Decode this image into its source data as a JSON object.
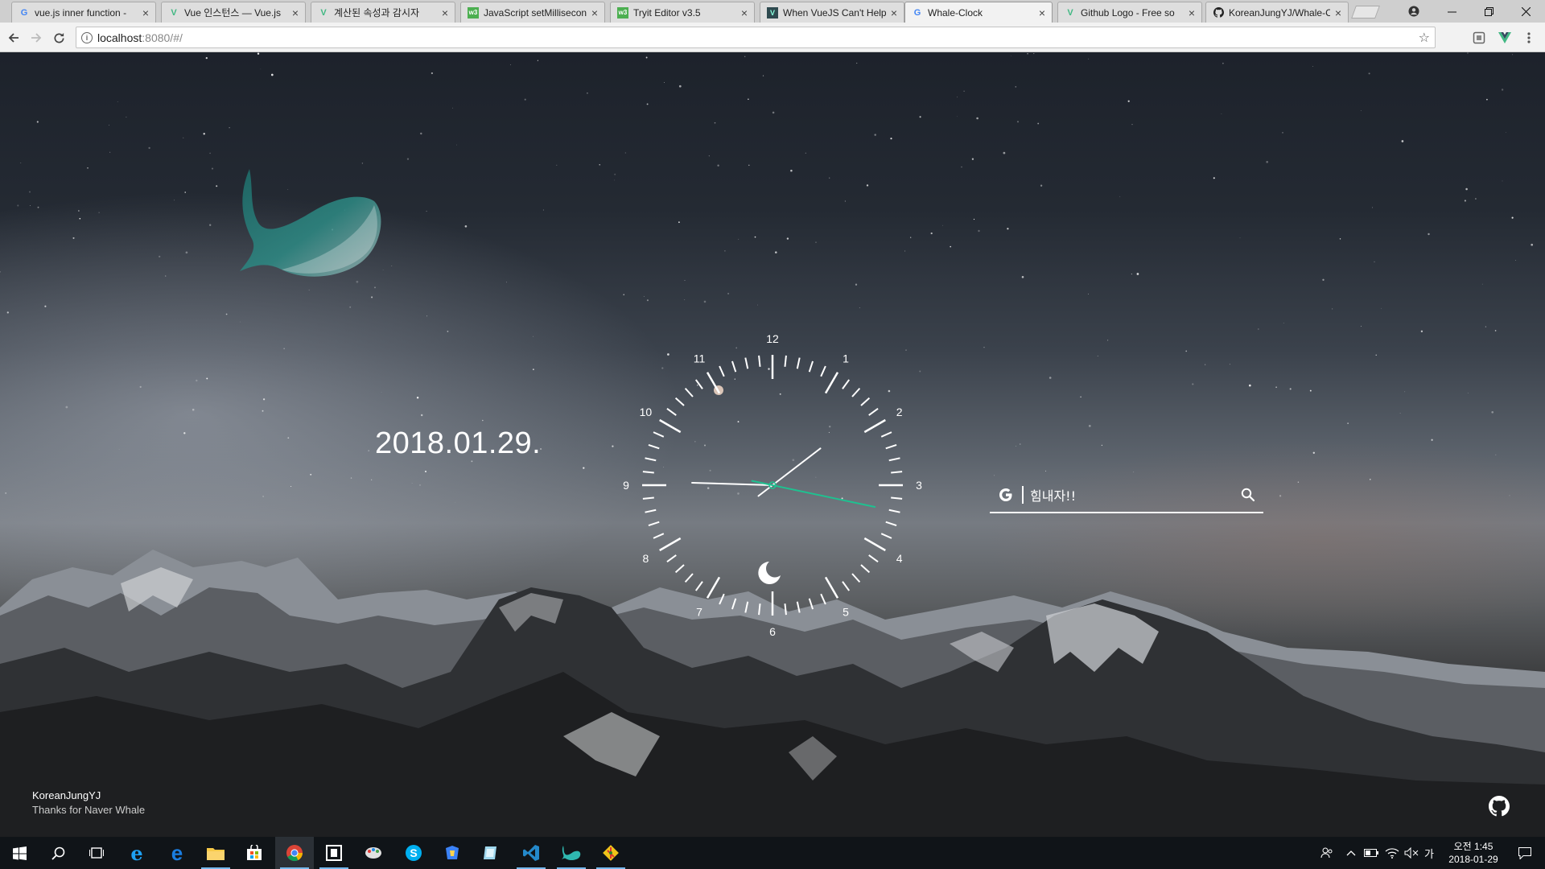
{
  "browser": {
    "tabs": [
      {
        "title": "vue.js inner function -",
        "favicon": "google-icon",
        "active": false
      },
      {
        "title": "Vue 인스턴스 — Vue.js",
        "favicon": "vue-icon",
        "active": false
      },
      {
        "title": "계산된 속성과 감시자",
        "favicon": "vue-icon",
        "active": false
      },
      {
        "title": "JavaScript setMillisecon",
        "favicon": "w3schools-icon",
        "active": false
      },
      {
        "title": "Tryit Editor v3.5",
        "favicon": "w3schools-icon",
        "active": false
      },
      {
        "title": "When VueJS Can't Help",
        "favicon": "medium-icon",
        "active": false
      },
      {
        "title": "Whale-Clock",
        "favicon": "google-icon",
        "active": true
      },
      {
        "title": "Github Logo - Free so",
        "favicon": "vue-icon",
        "active": false
      },
      {
        "title": "KoreanJungYJ/Whale-C",
        "favicon": "github-icon",
        "active": false
      }
    ],
    "tab_close_glyph": "×",
    "address": {
      "host": "localhost",
      "path": ":8080/#/"
    }
  },
  "page": {
    "date": "2018.01.29.",
    "clock": {
      "numbers": [
        "12",
        "1",
        "2",
        "3",
        "4",
        "5",
        "6",
        "7",
        "8",
        "9",
        "10",
        "11"
      ],
      "hour": 1,
      "minute": 45,
      "second": 17,
      "period_icon": "moon-icon",
      "second_hand_color": "#1fc190"
    },
    "search": {
      "value": "힘내자!!",
      "engine_icon": "google-g-icon"
    },
    "credit": {
      "author": "KoreanJungYJ",
      "thanks": "Thanks for Naver Whale"
    }
  },
  "taskbar": {
    "apps": [
      {
        "name": "start-icon"
      },
      {
        "name": "search-icon"
      },
      {
        "name": "task-view-icon"
      },
      {
        "name": "internet-explorer-icon"
      },
      {
        "name": "edge-icon"
      },
      {
        "name": "file-explorer-icon"
      },
      {
        "name": "store-icon"
      },
      {
        "name": "chrome-icon"
      },
      {
        "name": "app-icon"
      },
      {
        "name": "paint-icon"
      },
      {
        "name": "skype-icon"
      },
      {
        "name": "app-icon-2"
      },
      {
        "name": "app-icon-3"
      },
      {
        "name": "vscode-icon"
      },
      {
        "name": "whale-icon"
      },
      {
        "name": "git-icon"
      }
    ],
    "tray": {
      "ime": "가",
      "time": "오전 1:45",
      "date": "2018-01-29"
    }
  },
  "colors": {
    "accent": "#1fc190",
    "whale": "#2d8a84"
  }
}
